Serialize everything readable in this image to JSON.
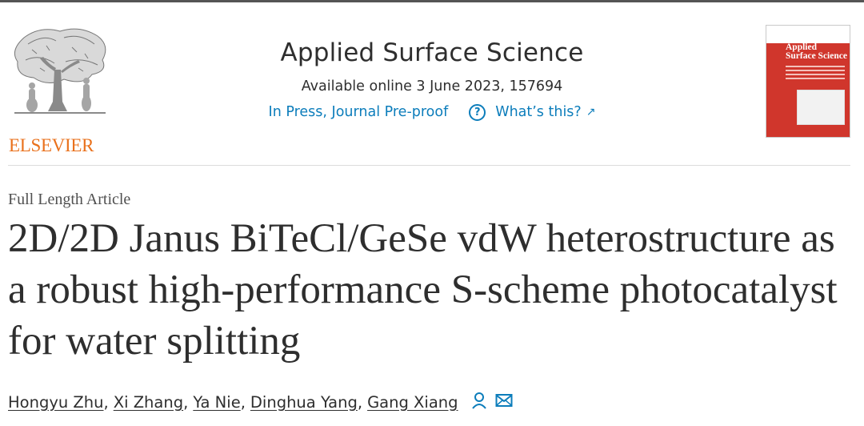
{
  "publisher": {
    "name": "ELSEVIER"
  },
  "journal": {
    "title": "Applied Surface Science",
    "available": "Available online 3 June 2023, 157694",
    "status": "In Press, Journal Pre-proof",
    "whats_this": "What’s this?",
    "help_icon_glyph": "?",
    "arrow_icon_glyph": "↗",
    "link_color": "#0c7dbb"
  },
  "cover": {
    "title_line1": "Applied",
    "title_line2": "Surface Science",
    "accent_color": "#d0362c"
  },
  "article": {
    "type": "Full Length Article",
    "title": "2D/2D Janus BiTeCl/GeSe vdW heterostructure as a robust high-performance S-scheme photocatalyst for water splitting"
  },
  "authors": [
    {
      "name": "Hongyu Zhu",
      "sep": ","
    },
    {
      "name": "Xi Zhang",
      "sep": ","
    },
    {
      "name": "Ya Nie",
      "sep": ","
    },
    {
      "name": "Dinghua Yang",
      "sep": ","
    },
    {
      "name": "Gang Xiang",
      "sep": ""
    }
  ],
  "icons": {
    "corresponding": "person-icon",
    "email": "envelope-icon"
  }
}
